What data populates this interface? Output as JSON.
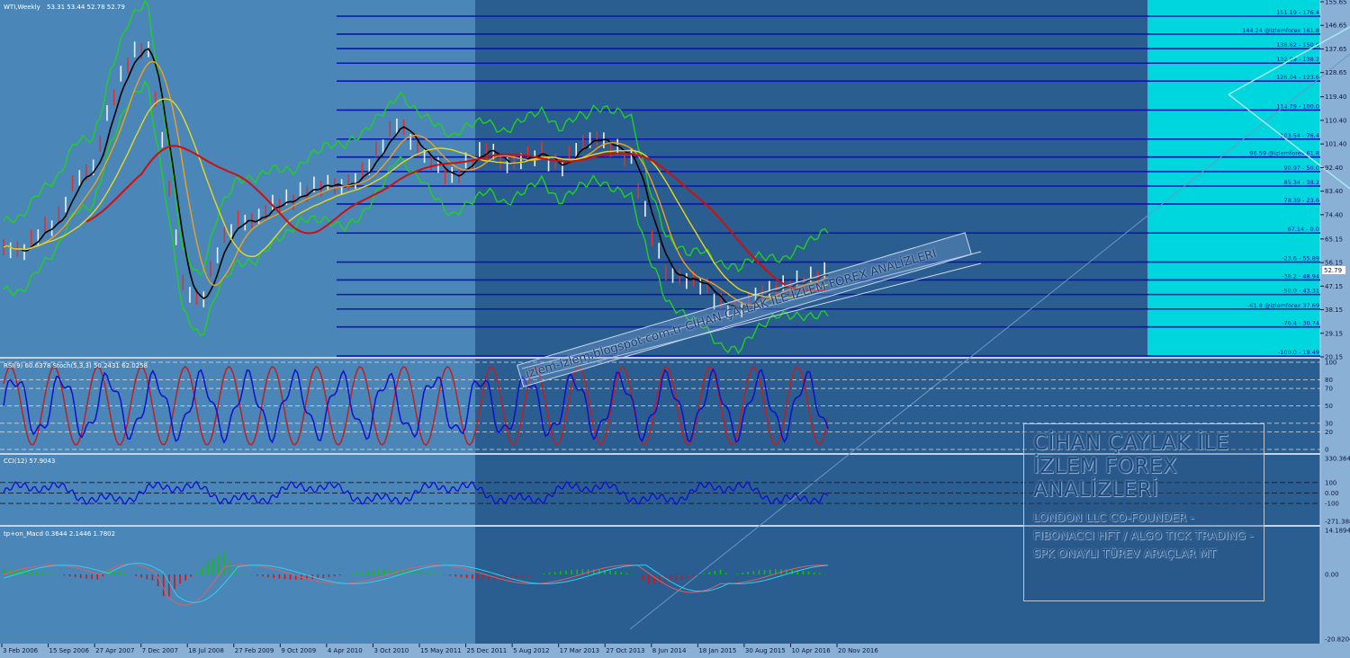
{
  "window": {
    "title": "WTI,Weekly",
    "ohlc": "53.31 53.44 52.78 52.79",
    "last_price": "52.79"
  },
  "colors": {
    "bg_left": "#4a86b8",
    "bg_right": "#225a8c",
    "fib_zone": "#00d6de",
    "fib_line": "#0a14b0",
    "rsi": "#1010d0",
    "stoch": "#c02020",
    "ma_black": "#000000",
    "ma_orange": "#f0a020",
    "ma_yellow": "#e8d820",
    "ma_red": "#cc1010",
    "bands": "#20d020",
    "macd_pos": "#10c010",
    "macd_neg": "#e01010"
  },
  "chart_data": [
    {
      "type": "line",
      "title": "WTI,Weekly",
      "x": [
        "3 Feb 2006",
        "15 Sep 2006",
        "27 Apr 2007",
        "7 Dec 2007",
        "18 Jul 2008",
        "27 Feb 2009",
        "9 Oct 2009",
        "4 Apr 2010",
        "3 Oct 2010",
        "15 May 2011",
        "25 Dec 2011",
        "5 Aug 2012",
        "17 Mar 2013",
        "27 Oct 2013",
        "8 Jun 2014",
        "18 Jan 2015",
        "30 Aug 2015",
        "10 Apr 2016",
        "20 Nov 2016"
      ],
      "y_ticks": [
        "155.65",
        "146.65",
        "137.65",
        "128.65",
        "119.40",
        "110.40",
        "101.40",
        "92.40",
        "83.40",
        "74.40",
        "65.15",
        "56.15",
        "47.15",
        "38.15",
        "29.15",
        "20.15"
      ],
      "ylim": [
        20.15,
        155.65
      ],
      "series": [
        {
          "values": [
            62,
            60,
            68,
            72,
            88,
            92,
            118,
            134,
            140,
            96,
            48,
            40,
            62,
            72,
            72,
            78,
            80,
            84,
            86,
            85,
            90,
            100,
            110,
            100,
            94,
            88,
            95,
            100,
            93,
            96,
            98,
            92,
            100,
            104,
            100,
            96,
            70,
            52,
            50,
            48,
            40,
            38,
            44,
            46,
            48,
            50,
            52.79
          ]
        }
      ],
      "fib_levels": [
        {
          "price": 176.4,
          "label": "151.19 - 176.4"
        },
        {
          "price": 161.8,
          "label": "144.24 @izlemforex 161.8"
        },
        {
          "price": 150.0,
          "label": "138.62 - 150.0"
        },
        {
          "price": 138.2,
          "label": "132.99 - 138.2"
        },
        {
          "price": 123.6,
          "label": "126.04 - 123.6"
        },
        {
          "price": 100.0,
          "label": "114.79 - 100.0"
        },
        {
          "price": 76.4,
          "label": "103.54 - 76.4"
        },
        {
          "price": 61.8,
          "label": "96.59 @izlemforex 61.8"
        },
        {
          "price": 50.0,
          "label": "90.97 - 50.0"
        },
        {
          "price": 38.2,
          "label": "85.34 - 38.2"
        },
        {
          "price": 23.6,
          "label": "78.39 - 23.6"
        },
        {
          "price": 0.0,
          "label": "67.14 - 0.0"
        },
        {
          "price": -23.6,
          "label": "-23.6 - 55.89"
        },
        {
          "price": -38.2,
          "label": "-38.2 - 48.94"
        },
        {
          "price": -50.0,
          "label": "-50.0 - 43.31"
        },
        {
          "price": -61.8,
          "label": "-61.8 @izlemforex 37.69"
        },
        {
          "price": -76.4,
          "label": "-76.4 - 30.74"
        },
        {
          "price": -100.0,
          "label": "-100.0 - 19.49"
        }
      ]
    },
    {
      "type": "line",
      "title": "RSI(9) 60.6378  Stoch(5,3,3) 50.2431 62.0258",
      "y_ticks": [
        "100",
        "80",
        "70",
        "50",
        "30",
        "20",
        "0"
      ],
      "ylim": [
        0,
        100
      ]
    },
    {
      "type": "line",
      "title": "CCI(12) 57.9043",
      "y_ticks": [
        "330.3649",
        "100",
        "0.00",
        "-100",
        "-271.3887"
      ],
      "ylim": [
        -271.3887,
        330.3649
      ]
    },
    {
      "type": "bar",
      "title": "tp+on_Macd 0.3644 2.1446 1.7802",
      "y_ticks": [
        "14.1894",
        "0.00",
        "-20.8204"
      ],
      "ylim": [
        -20.8204,
        14.1894
      ]
    }
  ],
  "brand": {
    "title": "CİHAN ÇAYLAK İLE İZLEM FOREX ANALİZLERİ",
    "subtitle": "LONDON LLC CO-FOUNDER - FIBONACCI HFT / ALGO TICK TRADING - SPK ONAYLI TÜREV ARAÇLAR MT"
  },
  "watermark": {
    "text": "izlem-izlem.blogspot.com.tr  CİHAN ÇAYLAK İLE İZLEM FOREX ANALİZLERİ"
  }
}
